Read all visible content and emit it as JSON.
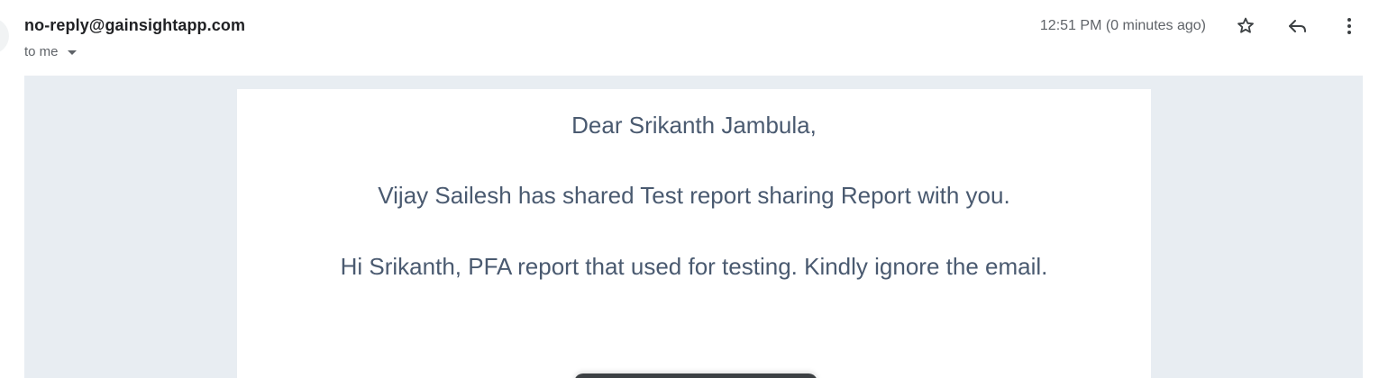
{
  "header": {
    "sender": "no-reply@gainsightapp.com",
    "recipient_label": "to me",
    "timestamp": "12:51 PM (0 minutes ago)",
    "icons": {
      "star": "star-icon",
      "reply": "reply-icon",
      "more": "more-vert-icon",
      "recipient_toggle": "caret-down-icon"
    }
  },
  "email": {
    "greeting": "Dear Srikanth Jambula,",
    "shared_text": "Vijay Sailesh has shared Test report sharing Report with you.",
    "note": "Hi Srikanth, PFA report that used for testing. Kindly ignore the email."
  },
  "colors": {
    "body_background": "#e8edf2",
    "text": "#4a5a70",
    "card": "#ffffff"
  }
}
